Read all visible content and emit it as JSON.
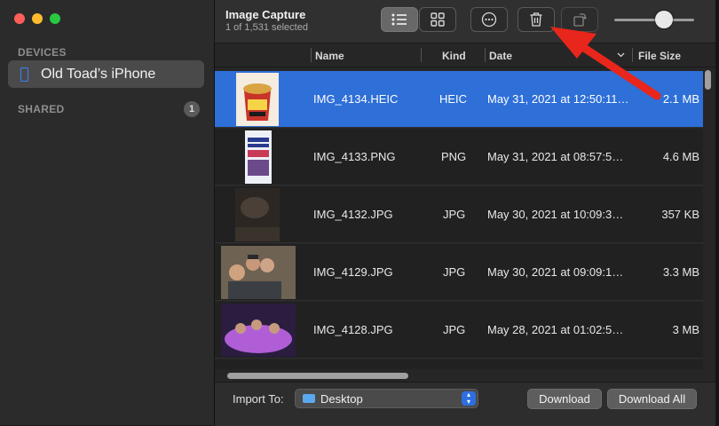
{
  "sidebar": {
    "devices_label": "DEVICES",
    "device_name": "Old Toad’s iPhone",
    "shared_label": "SHARED",
    "shared_count": "1"
  },
  "toolbar": {
    "title": "Image Capture",
    "subtitle": "1 of 1,531 selected",
    "icons": [
      "list-view-icon",
      "grid-view-icon",
      "more-options-icon",
      "trash-icon",
      "rotate-icon"
    ],
    "zoom_slider_level": 0.55
  },
  "columns": {
    "name": "Name",
    "kind": "Kind",
    "date": "Date",
    "size": "File Size"
  },
  "rows": [
    {
      "name": "IMG_4134.HEIC",
      "kind": "HEIC",
      "date": "May 31, 2021 at 12:50:11…",
      "size": "2.1 MB",
      "selected": true
    },
    {
      "name": "IMG_4133.PNG",
      "kind": "PNG",
      "date": "May 31, 2021 at 08:57:5…",
      "size": "4.6 MB",
      "selected": false
    },
    {
      "name": "IMG_4132.JPG",
      "kind": "JPG",
      "date": "May 30, 2021 at 10:09:3…",
      "size": "357 KB",
      "selected": false
    },
    {
      "name": "IMG_4129.JPG",
      "kind": "JPG",
      "date": "May 30, 2021 at 09:09:1…",
      "size": "3.3 MB",
      "selected": false
    },
    {
      "name": "IMG_4128.JPG",
      "kind": "JPG",
      "date": "May 28, 2021 at 01:02:5…",
      "size": "3 MB",
      "selected": false
    }
  ],
  "footer": {
    "import_label": "Import To:",
    "destination": "Desktop",
    "download_label": "Download",
    "download_all_label": "Download All"
  },
  "colors": {
    "selection": "#2e6fd8",
    "annotation_arrow": "#e8261c"
  }
}
